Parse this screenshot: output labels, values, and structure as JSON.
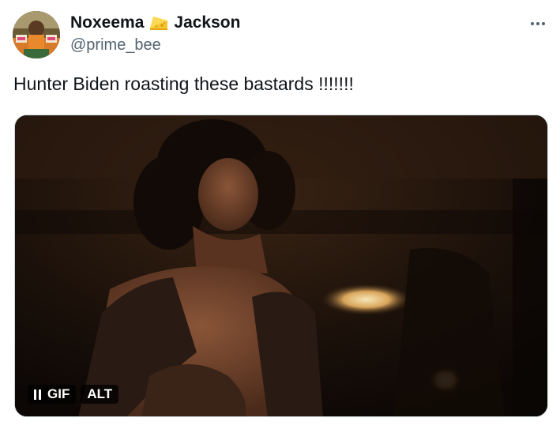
{
  "author": {
    "name_first": "Noxeema",
    "name_emoji": "cheese-wedge-icon",
    "name_last": "Jackson",
    "handle": "@prime_bee"
  },
  "tweet": {
    "text": "Hunter Biden roasting these bastards !!!!!!!"
  },
  "media": {
    "type": "gif",
    "gif_badge": "GIF",
    "alt_badge": "ALT",
    "playing": true
  },
  "colors": {
    "text_primary": "#0f1419",
    "text_secondary": "#536471",
    "media_border": "#cfd9de"
  }
}
